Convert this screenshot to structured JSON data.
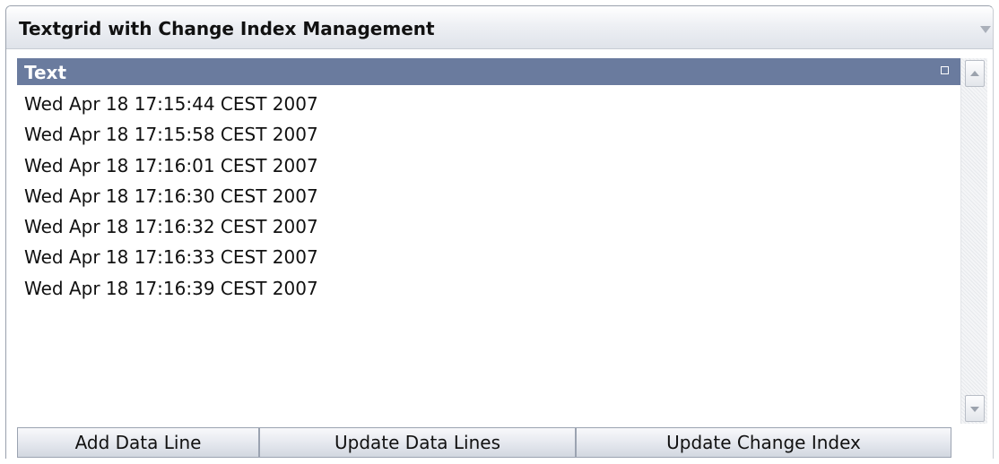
{
  "panel": {
    "title": "Textgrid with Change Index Management",
    "collapse_icon": "triangle-down-icon"
  },
  "grid": {
    "column_header": "Text",
    "header_icon": "square-icon",
    "rows": [
      "Wed Apr 18 17:15:44 CEST 2007",
      "Wed Apr 18 17:15:58 CEST 2007",
      "Wed Apr 18 17:16:01 CEST 2007",
      "Wed Apr 18 17:16:30 CEST 2007",
      "Wed Apr 18 17:16:32 CEST 2007",
      "Wed Apr 18 17:16:33 CEST 2007",
      "Wed Apr 18 17:16:39 CEST 2007"
    ]
  },
  "scrollbar": {
    "up_icon": "arrow-up-icon",
    "down_icon": "arrow-down-icon"
  },
  "buttons": {
    "add": "Add Data Line",
    "update_lines": "Update Data Lines",
    "update_index": "Update Change Index"
  },
  "colors": {
    "header_bg": "#6a7b9e",
    "header_text": "#ffffff"
  }
}
